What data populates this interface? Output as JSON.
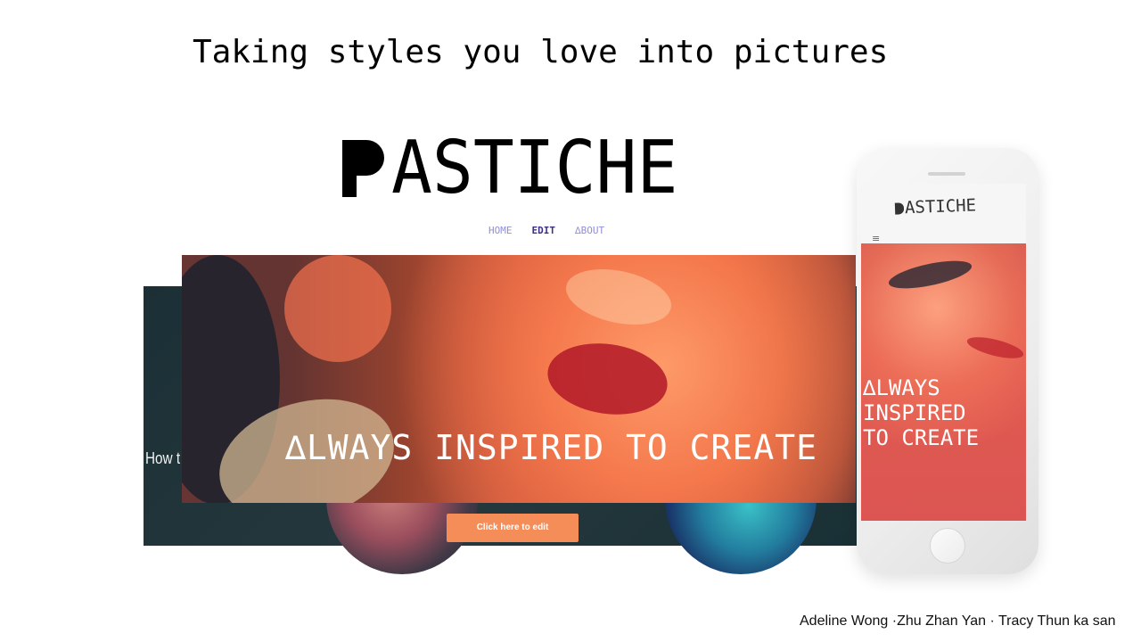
{
  "slide": {
    "headline": "Taking styles you love into pictures",
    "credits": "Adeline Wong ·Zhu Zhan Yan · Tracy Thun ka san"
  },
  "desktop_site": {
    "logo": {
      "initial": "P",
      "remaining": "ASTICHE"
    },
    "nav": {
      "home": "HOME",
      "edit": "EDIT",
      "about": "∆BOUT"
    },
    "background_card_text": "How t",
    "hero_text": "∆LWAYS INSPIRED TO CREATE",
    "edit_button": "Click here to edit"
  },
  "mobile_site": {
    "logo": {
      "initial": "P",
      "remaining": "ASTICHE"
    },
    "menu_icon": "≡",
    "hero_text": "∆LWAYS\nINSPIRED\nTO CREATE"
  },
  "icons": {
    "menu": "hamburger-menu-icon"
  },
  "colors": {
    "nav": "#8f8fd8",
    "nav_active": "#3c2f86",
    "button": "#f58d58",
    "card_dark": "#1f343a"
  }
}
